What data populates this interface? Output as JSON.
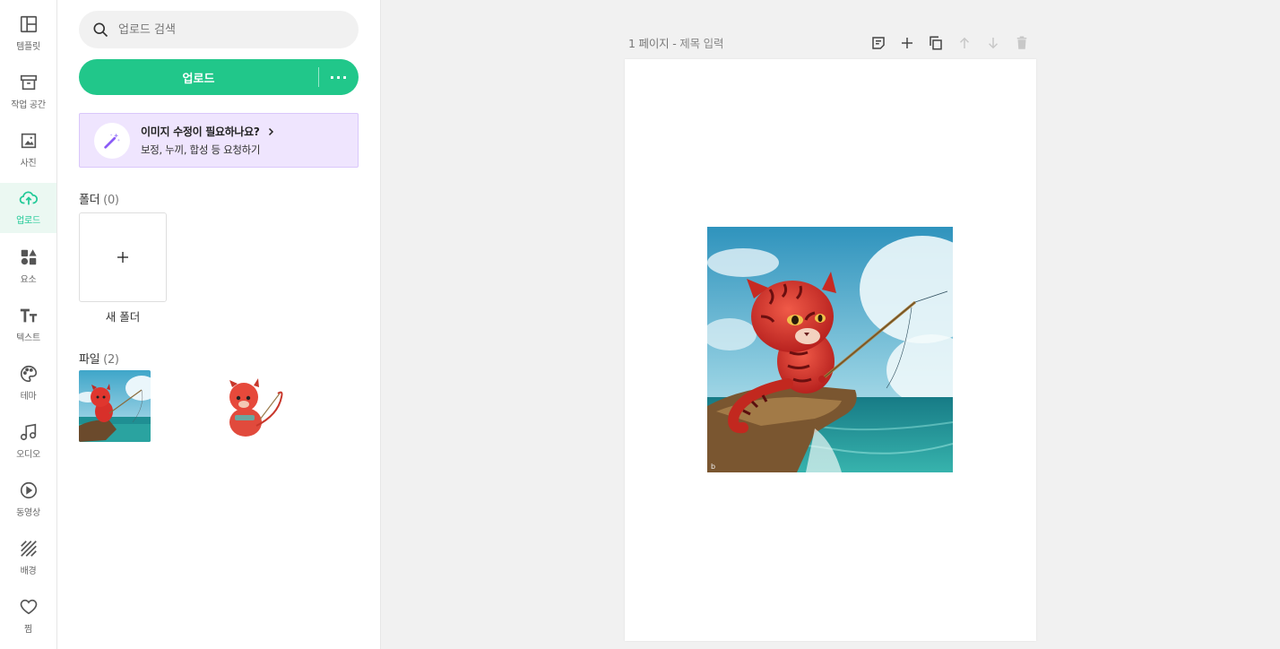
{
  "rail": {
    "items": [
      {
        "label": "템플릿",
        "icon": "template-icon"
      },
      {
        "label": "작업 공간",
        "icon": "archive-icon"
      },
      {
        "label": "사진",
        "icon": "image-icon"
      },
      {
        "label": "업로드",
        "icon": "upload-cloud-icon",
        "active": true
      },
      {
        "label": "요소",
        "icon": "shapes-icon"
      },
      {
        "label": "텍스트",
        "icon": "text-icon"
      },
      {
        "label": "테마",
        "icon": "palette-icon"
      },
      {
        "label": "오디오",
        "icon": "music-icon"
      },
      {
        "label": "동영상",
        "icon": "play-circle-icon"
      },
      {
        "label": "배경",
        "icon": "stripes-icon"
      },
      {
        "label": "찜",
        "icon": "heart-icon"
      }
    ]
  },
  "panel": {
    "search_placeholder": "업로드 검색",
    "upload_label": "업로드",
    "upload_more": "···",
    "promo": {
      "title": "이미지 수정이 필요하나요?",
      "subtitle": "보정, 누끼, 합성 등 요청하기"
    },
    "folders": {
      "label": "폴더",
      "count": "(0)",
      "new_folder_label": "새 폴더"
    },
    "files": {
      "label": "파일",
      "count": "(2)"
    }
  },
  "canvas": {
    "page_number": "1 페이지",
    "separator": " - ",
    "title_placeholder": "제목 입력"
  },
  "colors": {
    "accent": "#21c78a",
    "promo_bg": "#efe5fe",
    "workspace_bg": "#f1f1f1"
  }
}
